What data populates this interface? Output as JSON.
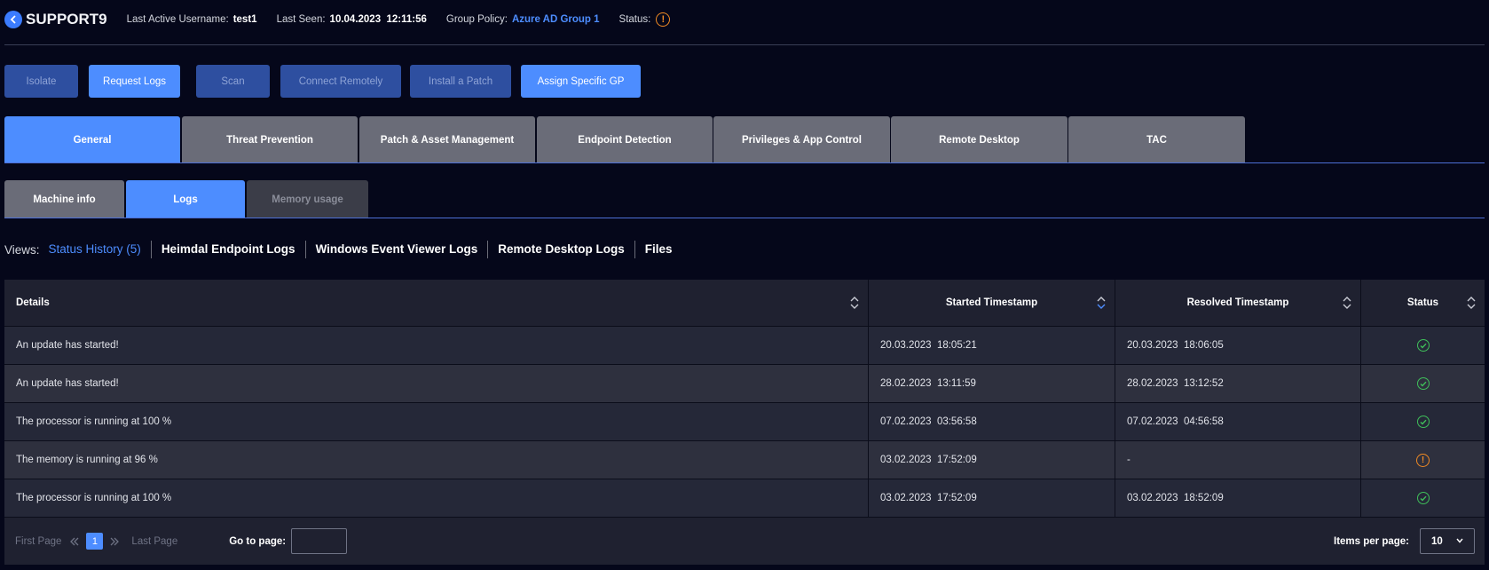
{
  "header": {
    "back_icon": "chevron-left-icon",
    "machine_name": "SUPPORT9",
    "last_user_label": "Last Active Username:",
    "last_user_value": "test1",
    "last_seen_label": "Last Seen:",
    "last_seen_value": "10.04.2023  12:11:56",
    "group_policy_label": "Group Policy:",
    "group_policy_value": "Azure AD Group 1",
    "status_label": "Status:",
    "status_icon": "warning-icon"
  },
  "actions": [
    "Isolate",
    "Request Logs",
    "Scan",
    "Connect Remotely",
    "Install a Patch",
    "Assign Specific GP"
  ],
  "tabs": [
    "General",
    "Threat Prevention",
    "Patch & Asset Management",
    "Endpoint Detection",
    "Privileges & App Control",
    "Remote Desktop",
    "TAC"
  ],
  "subtabs": [
    "Machine info",
    "Logs",
    "Memory usage"
  ],
  "views": {
    "label": "Views:",
    "items": [
      "Status History (5)",
      "Heimdal Endpoint Logs",
      "Windows Event Viewer Logs",
      "Remote Desktop Logs",
      "Files"
    ]
  },
  "table": {
    "headers": [
      "Details",
      "Started Timestamp",
      "Resolved Timestamp",
      "Status"
    ],
    "rows": [
      {
        "details": "An update has started!",
        "started": "20.03.2023  18:05:21",
        "resolved": "20.03.2023  18:06:05",
        "status": "resolved"
      },
      {
        "details": "An update has started!",
        "started": "28.02.2023  13:11:59",
        "resolved": "28.02.2023  13:12:52",
        "status": "resolved"
      },
      {
        "details": "The processor is running at 100 %",
        "started": "07.02.2023  03:56:58",
        "resolved": "07.02.2023  04:56:58",
        "status": "resolved"
      },
      {
        "details": "The memory is running at 96 %",
        "started": "03.02.2023  17:52:09",
        "resolved": "-",
        "status": "warning"
      },
      {
        "details": "The processor is running at 100 %",
        "started": "03.02.2023  17:52:09",
        "resolved": "03.02.2023  18:52:09",
        "status": "resolved"
      }
    ]
  },
  "pagination": {
    "first_page": "First Page",
    "current_page": "1",
    "last_page": "Last Page",
    "goto_label": "Go to page:",
    "goto_value": "",
    "items_per_page_label": "Items per page:",
    "items_per_page_value": "10"
  },
  "colors": {
    "background": "#05071a",
    "accent": "#4d8dff",
    "success": "#3fbf5a",
    "warning": "#f08a24"
  }
}
